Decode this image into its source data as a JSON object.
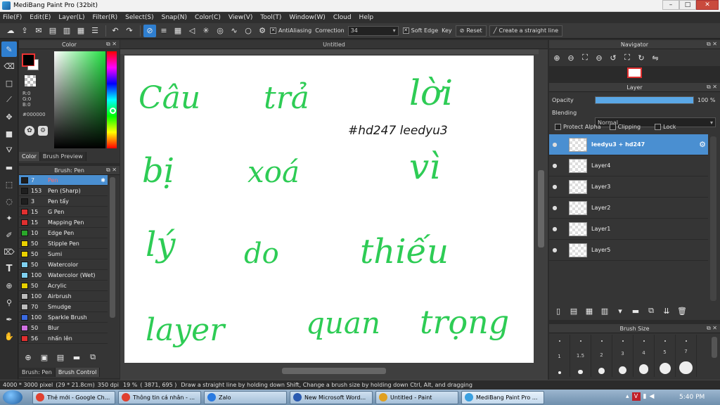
{
  "window": {
    "title": "MediBang Paint Pro (32bit)",
    "minimize": "–",
    "maximize": "□",
    "close": "✕"
  },
  "menu": [
    "File(F)",
    "Edit(E)",
    "Layer(L)",
    "Filter(R)",
    "Select(S)",
    "Snap(N)",
    "Color(C)",
    "View(V)",
    "Tool(T)",
    "Window(W)",
    "Cloud",
    "Help"
  ],
  "toolbar": {
    "antialiasing_label": "AntiAliasing",
    "correction_label": "Correction",
    "correction_value": "34",
    "soft_edge_label": "Soft Edge",
    "key_label": "Key",
    "reset_label": "Reset",
    "straight_line_label": "Create a straight line"
  },
  "color_panel": {
    "title": "Color",
    "r_label": "R:0",
    "g_label": "G:0",
    "b_label": "B:0",
    "hex": "#000000",
    "tabs": [
      "Color",
      "Brush Preview"
    ],
    "foreground": "#000000",
    "background": "#ffffff"
  },
  "brush_panel": {
    "title": "Brush: Pen",
    "items": [
      {
        "size": "7",
        "name": "Pen",
        "color": "#1e1e1e",
        "selected": true
      },
      {
        "size": "153",
        "name": "Pen (Sharp)",
        "color": "#1e1e1e"
      },
      {
        "size": "3",
        "name": "Pen tẩy",
        "color": "#1e1e1e"
      },
      {
        "size": "15",
        "name": "G Pen",
        "color": "#e03030"
      },
      {
        "size": "15",
        "name": "Mapping Pen",
        "color": "#e03030"
      },
      {
        "size": "10",
        "name": "Edge Pen",
        "color": "#2aa82a"
      },
      {
        "size": "50",
        "name": "Stipple Pen",
        "color": "#e8d000"
      },
      {
        "size": "50",
        "name": "Sumi",
        "color": "#e8d000"
      },
      {
        "size": "50",
        "name": "Watercolor",
        "color": "#7fd0f0"
      },
      {
        "size": "100",
        "name": "Watercolor (Wet)",
        "color": "#7fd0f0"
      },
      {
        "size": "50",
        "name": "Acrylic",
        "color": "#e8d000"
      },
      {
        "size": "100",
        "name": "Airbrush",
        "color": "#bbbbbb"
      },
      {
        "size": "70",
        "name": "Smudge",
        "color": "#bbbbbb"
      },
      {
        "size": "100",
        "name": "Sparkle Brush",
        "color": "#3a6ae0"
      },
      {
        "size": "50",
        "name": "Blur",
        "color": "#d070e0"
      },
      {
        "size": "56",
        "name": "nhấn lên",
        "color": "#e03030"
      }
    ],
    "tabs": [
      "Brush: Pen",
      "Brush Control"
    ]
  },
  "canvas": {
    "tab_title": "Untitled",
    "art_color": "#2ecc55",
    "script_words": [
      "Câu",
      "trả",
      "lời",
      "bị",
      "xoá",
      "vì",
      "lý",
      "do",
      "thiếu",
      "layer",
      "quan",
      "trọng"
    ],
    "signature": "#hd247   leedyu3"
  },
  "navigator": {
    "title": "Navigator"
  },
  "layer_panel": {
    "title": "Layer",
    "opacity_label": "Opacity",
    "opacity_value": "100 %",
    "opacity_fraction": 1.0,
    "blending_label": "Blending",
    "blending_value": "Normal",
    "protect_alpha": "Protect Alpha",
    "clipping": "Clipping",
    "lock": "Lock",
    "layers": [
      {
        "name": "leedyu3 + hd247",
        "selected": true
      },
      {
        "name": "Layer4"
      },
      {
        "name": "Layer3"
      },
      {
        "name": "Layer2"
      },
      {
        "name": "Layer1"
      },
      {
        "name": "Layer5"
      }
    ]
  },
  "brush_size_panel": {
    "title": "Brush Size",
    "sizes": [
      "1",
      "1.5",
      "2",
      "3",
      "4",
      "5",
      "7"
    ]
  },
  "status": {
    "size": "4000 * 3000 pixel",
    "cm": "(29 * 21.8cm)",
    "dpi": "350 dpi",
    "zoom": "19 %",
    "coords": "( 3871, 695 )",
    "hint": "Draw a straight line by holding down Shift, Change a brush size by holding down Ctrl, Alt, and dragging"
  },
  "taskbar": {
    "items": [
      {
        "label": "Thẻ mới - Google Ch...",
        "color": "#e04030"
      },
      {
        "label": "Thông tin cá nhân - ...",
        "color": "#e04030"
      },
      {
        "label": "Zalo",
        "color": "#2a7ae0"
      },
      {
        "label": "New Microsoft Word...",
        "color": "#2a5ab0"
      },
      {
        "label": "Untitled - Paint",
        "color": "#e0a020"
      },
      {
        "label": "MediBang Paint Pro ...",
        "color": "#3aa0e0"
      }
    ],
    "time": "5:40 PM"
  }
}
